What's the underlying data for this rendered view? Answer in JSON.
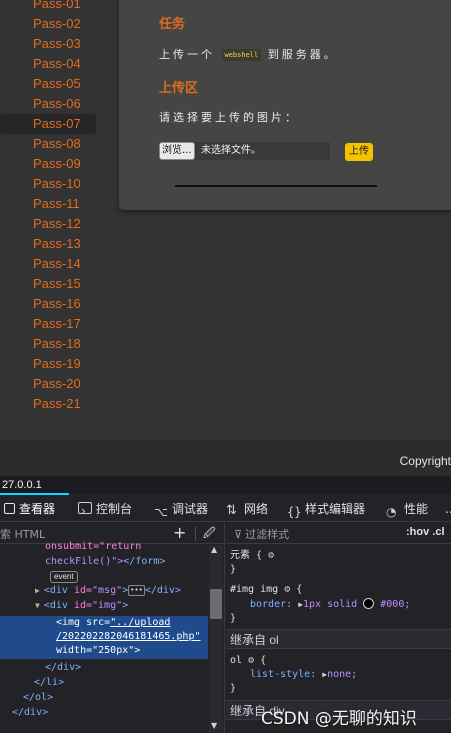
{
  "sidebar": {
    "items": [
      "Pass-01",
      "Pass-02",
      "Pass-03",
      "Pass-04",
      "Pass-05",
      "Pass-06",
      "Pass-07",
      "Pass-08",
      "Pass-09",
      "Pass-10",
      "Pass-11",
      "Pass-12",
      "Pass-13",
      "Pass-14",
      "Pass-15",
      "Pass-16",
      "Pass-17",
      "Pass-18",
      "Pass-19",
      "Pass-20",
      "Pass-21"
    ],
    "active_index": 6,
    "color": "#e06c1c"
  },
  "content": {
    "task_title": "任务",
    "task_text_before": "上传一个",
    "task_code": "webshell",
    "task_text_after": "到服务器。",
    "upload_title": "上传区",
    "choose_text": "请选择要上传的图片：",
    "browse_label": "浏览...",
    "file_status": "未选择文件。",
    "upload_label": "上传",
    "accent": "#e06c1c",
    "button_color": "#f5c100"
  },
  "footer": {
    "text": "Copyright"
  },
  "devtools": {
    "url": "27.0.0.1",
    "tabs": [
      "查看器",
      "控制台",
      "调试器",
      "网络",
      "样式编辑器",
      "性能",
      "..."
    ],
    "search_placeholder": "索 HTML",
    "plus": "+",
    "picker": "🖉",
    "tree": {
      "l1": "onsubmit=\"return",
      "l2_text": "checkFile()\">",
      "l2_close": "</form>",
      "l3_badge": "event",
      "l4_tag": "<div",
      "l4_attr": "id=",
      "l4_val": "\"msg\"",
      "l4_end": ">",
      "l4_close": "</div>",
      "l5_tag": "<div",
      "l5_attr": "id=",
      "l5_val": "\"img\"",
      "l5_end": ">",
      "l6_tag": "<img",
      "l6_attr": "src=",
      "l6_val": "\"../upload",
      "l7_val": "/202202282046181465.php\"",
      "l8_attr": "width=",
      "l8_val": "\"250px\"",
      "l8_end": ">",
      "l9": "</div>",
      "l10": "</li>",
      "l11": "</ol>",
      "l12": "</div>"
    },
    "rules": {
      "filter_placeholder": "过滤样式",
      "hov": ":hov  .cl",
      "element_sel": "元素 {",
      "element_close": "}",
      "img_sel": "#img img",
      "img_open": "{",
      "img_prop": "border:",
      "img_val": "1px solid",
      "img_color": "#000;",
      "img_close": "}",
      "inherit1": "继承自 ol",
      "ol_sel": "ol",
      "ol_open": "{",
      "ol_prop": "list-style:",
      "ol_val": "none;",
      "ol_close": "}",
      "inherit2": "继承自 div"
    },
    "watermark": "CSDN @无聊的知识"
  }
}
